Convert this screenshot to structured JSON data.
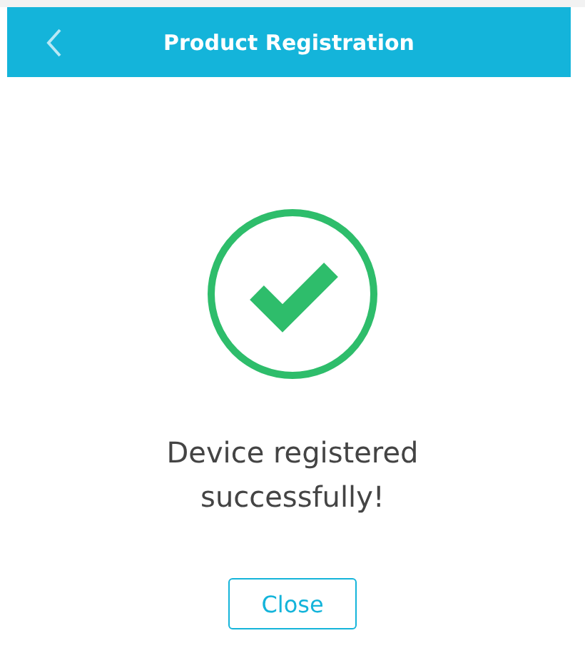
{
  "header": {
    "title": "Product Registration"
  },
  "message": "Device registered successfully!",
  "button": {
    "label": "Close"
  }
}
